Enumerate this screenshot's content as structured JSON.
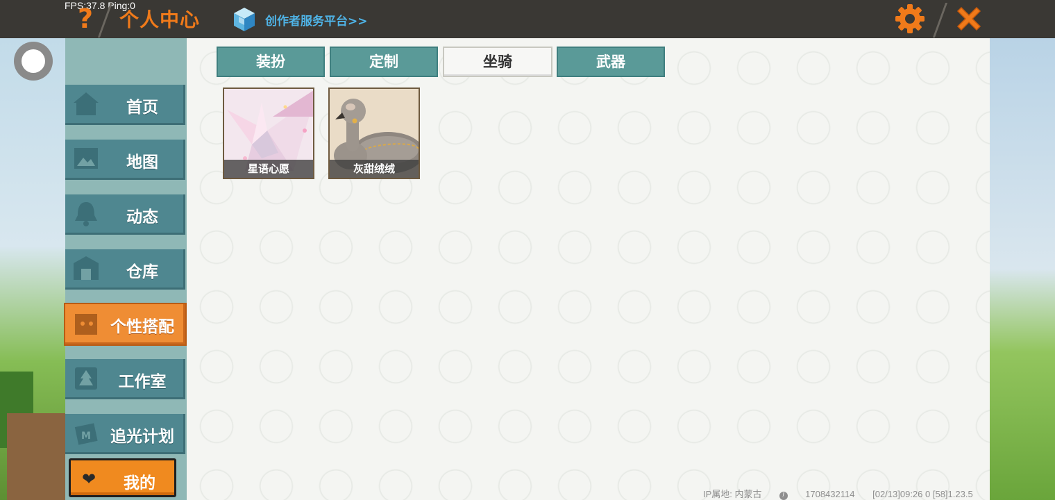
{
  "debug": {
    "fps_ping": "FPS:37.8  Ping:0"
  },
  "header": {
    "title": "个人中心",
    "help_glyph": "?",
    "creator_link": "创作者服务平台>>"
  },
  "sidebar": {
    "items": [
      {
        "label": "首页",
        "icon": "home-icon"
      },
      {
        "label": "地图",
        "icon": "map-icon"
      },
      {
        "label": "动态",
        "icon": "bell-icon"
      },
      {
        "label": "仓库",
        "icon": "warehouse-icon"
      },
      {
        "label": "个性搭配",
        "icon": "outfit-icon"
      },
      {
        "label": "工作室",
        "icon": "studio-icon"
      },
      {
        "label": "追光计划",
        "icon": "light-chase-icon"
      }
    ],
    "active_index": 4,
    "mine_label": "我的"
  },
  "tabs": [
    "装扮",
    "定制",
    "坐骑",
    "武器"
  ],
  "active_tab": 2,
  "items": [
    {
      "name": "星语心愿",
      "icon": "paper-crane-mount-icon"
    },
    {
      "name": "灰甜绒绒",
      "icon": "swan-mount-icon"
    }
  ],
  "footer": {
    "ip": "IP属地: 内蒙古",
    "uid": "1708432114",
    "version": "[02/13]09:26 0  [58]1.23.5"
  },
  "colors": {
    "accent": "#f07a1a",
    "sidebar": "#4f8790",
    "tab": "#5a9a98",
    "link": "#4fb3e6"
  }
}
